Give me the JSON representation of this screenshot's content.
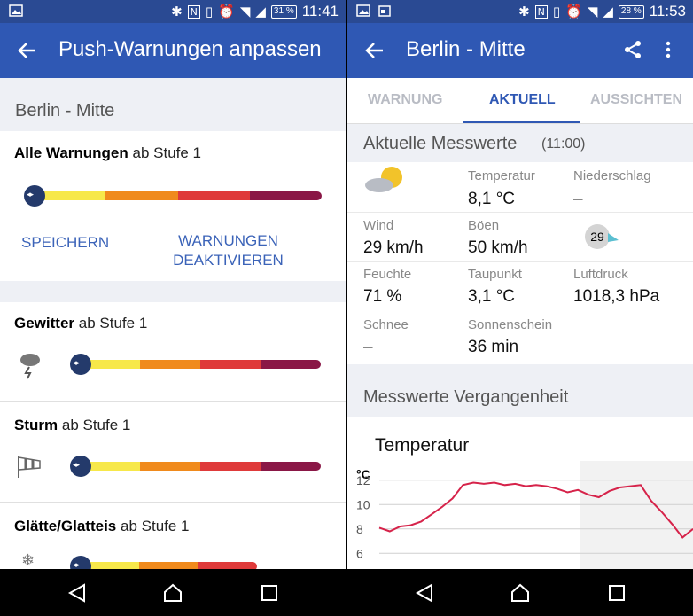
{
  "left": {
    "status": {
      "battery": "31 %",
      "time": "11:41"
    },
    "title": "Push-Warnungen anpassen",
    "location": "Berlin - Mitte",
    "all_warnings": {
      "label": "Alle Warnungen",
      "level": "ab Stufe 1",
      "level_value": 1
    },
    "buttons": {
      "save": "SPEICHERN",
      "deactivate_line1": "WARNUNGEN",
      "deactivate_line2": "DEAKTIVIEREN"
    },
    "categories": [
      {
        "label": "Gewitter",
        "level": "ab Stufe 1",
        "icon": "thunderstorm-icon"
      },
      {
        "label": "Sturm",
        "level": "ab Stufe 1",
        "icon": "windsock-icon"
      },
      {
        "label": "Glätte/Glatteis",
        "level": "ab Stufe 1",
        "icon": "snowflake-icon"
      }
    ],
    "scale_colors": [
      "#f7e84a",
      "#f08a1c",
      "#df3a3a",
      "#8a1746"
    ]
  },
  "right": {
    "status": {
      "battery": "28 %",
      "time": "11:53"
    },
    "title": "Berlin - Mitte",
    "tabs": [
      "WARNUNG",
      "AKTUELL",
      "AUSSICHTEN"
    ],
    "active_tab": "AKTUELL",
    "current": {
      "header": "Aktuelle Messwerte",
      "time": "(11:00)",
      "temperature": {
        "label": "Temperatur",
        "value": "8,1 °C"
      },
      "precipitation": {
        "label": "Niederschlag",
        "value": "–"
      },
      "wind": {
        "label": "Wind",
        "value": "29 km/h"
      },
      "gusts": {
        "label": "Böen",
        "value": "50 km/h"
      },
      "wind_badge": "29",
      "humidity": {
        "label": "Feuchte",
        "value": "71 %"
      },
      "dewpoint": {
        "label": "Taupunkt",
        "value": "3,1 °C"
      },
      "pressure": {
        "label": "Luftdruck",
        "value": "1018,3 hPa"
      },
      "snow": {
        "label": "Schnee",
        "value": "–"
      },
      "sunshine": {
        "label": "Sonnenschein",
        "value": "36 min"
      }
    },
    "history_header": "Messwerte Vergangenheit"
  },
  "chart_data": {
    "type": "line",
    "title": "Temperatur",
    "ylabel": "°C",
    "yticks": [
      "12",
      "10",
      "8",
      "6"
    ],
    "ylim": [
      5,
      13
    ],
    "series": [
      {
        "values": [
          8.1,
          7.8,
          8.2,
          8.3,
          8.6,
          9.2,
          9.8,
          10.5,
          11.6,
          11.8,
          11.7,
          11.8,
          11.6,
          11.7,
          11.5,
          11.6,
          11.5,
          11.3,
          11.0,
          11.2,
          10.8,
          10.6,
          11.1,
          11.4,
          11.5,
          11.6,
          10.3,
          9.4,
          8.4,
          7.3,
          8.0
        ]
      }
    ],
    "color": "#d6234a"
  }
}
